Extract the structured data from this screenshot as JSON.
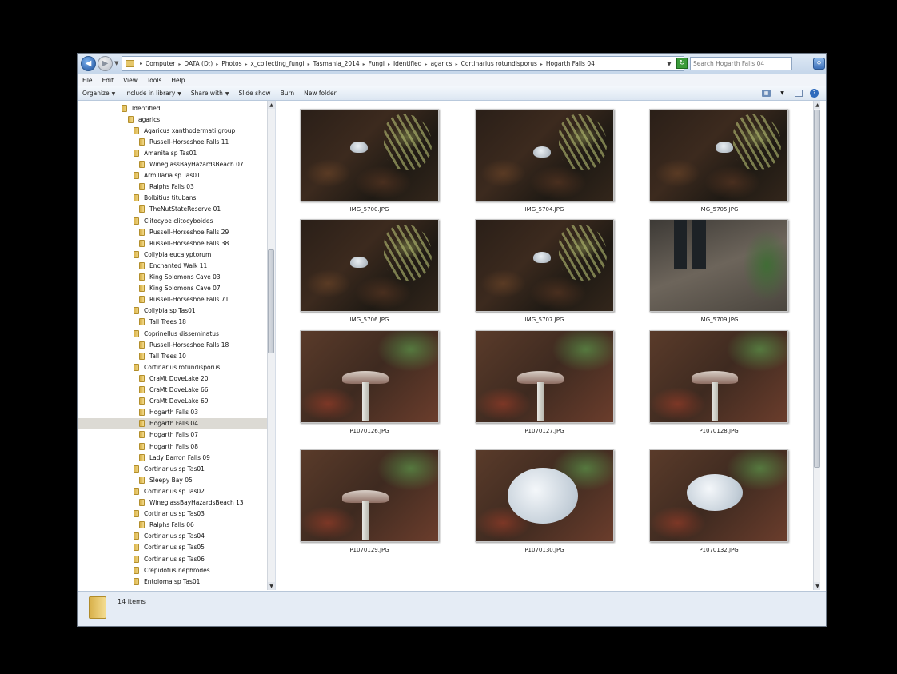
{
  "address": {
    "crumbs": [
      "Computer",
      "DATA (D:)",
      "Photos",
      "x_collecting_fungi",
      "Tasmania_2014",
      "Fungi",
      "Identified",
      "agarics",
      "Cortinarius rotundisporus",
      "Hogarth Falls 04"
    ],
    "search_placeholder": "Search Hogarth Falls 04"
  },
  "menu": [
    "File",
    "Edit",
    "View",
    "Tools",
    "Help"
  ],
  "toolbar": {
    "organize": "Organize",
    "include_in_library": "Include in library",
    "share_with": "Share with",
    "slide_show": "Slide show",
    "burn": "Burn",
    "new_folder": "New folder"
  },
  "tree": [
    {
      "label": "Identified",
      "level": 0
    },
    {
      "label": "agarics",
      "level": 1
    },
    {
      "label": "Agaricus xanthodermati group",
      "level": 2
    },
    {
      "label": "Russell-Horseshoe Falls 11",
      "level": 3
    },
    {
      "label": "Amanita sp Tas01",
      "level": 2
    },
    {
      "label": "WineglassBayHazardsBeach 07",
      "level": 3
    },
    {
      "label": "Armillaria sp Tas01",
      "level": 2
    },
    {
      "label": "Ralphs Falls 03",
      "level": 3
    },
    {
      "label": "Bolbitius titubans",
      "level": 2
    },
    {
      "label": "TheNutStateReserve 01",
      "level": 3
    },
    {
      "label": "Clitocybe clitocyboides",
      "level": 2
    },
    {
      "label": "Russell-Horseshoe Falls 29",
      "level": 3
    },
    {
      "label": "Russell-Horseshoe Falls 38",
      "level": 3
    },
    {
      "label": "Collybia eucalyptorum",
      "level": 2
    },
    {
      "label": "Enchanted Walk 11",
      "level": 3
    },
    {
      "label": "King Solomons Cave 03",
      "level": 3
    },
    {
      "label": "King Solomons Cave 07",
      "level": 3
    },
    {
      "label": "Russell-Horseshoe Falls 71",
      "level": 3
    },
    {
      "label": "Collybia sp Tas01",
      "level": 2
    },
    {
      "label": "Tall Trees 18",
      "level": 3
    },
    {
      "label": "Coprinellus disseminatus",
      "level": 2
    },
    {
      "label": "Russell-Horseshoe Falls 18",
      "level": 3
    },
    {
      "label": "Tall Trees 10",
      "level": 3
    },
    {
      "label": "Cortinarius rotundisporus",
      "level": 2
    },
    {
      "label": "CraMt DoveLake 20",
      "level": 3
    },
    {
      "label": "CraMt DoveLake 66",
      "level": 3
    },
    {
      "label": "CraMt DoveLake 69",
      "level": 3
    },
    {
      "label": "Hogarth Falls 03",
      "level": 3
    },
    {
      "label": "Hogarth Falls 04",
      "level": 3,
      "selected": true
    },
    {
      "label": "Hogarth Falls 07",
      "level": 3
    },
    {
      "label": "Hogarth Falls 08",
      "level": 3
    },
    {
      "label": "Lady Barron Falls 09",
      "level": 3
    },
    {
      "label": "Cortinarius sp Tas01",
      "level": 2
    },
    {
      "label": "Sleepy Bay 05",
      "level": 3
    },
    {
      "label": "Cortinarius sp Tas02",
      "level": 2
    },
    {
      "label": "WineglassBayHazardsBeach 13",
      "level": 3
    },
    {
      "label": "Cortinarius sp Tas03",
      "level": 2
    },
    {
      "label": "Ralphs Falls 06",
      "level": 3
    },
    {
      "label": "Cortinarius sp Tas04",
      "level": 2
    },
    {
      "label": "Cortinarius sp Tas05",
      "level": 2
    },
    {
      "label": "Cortinarius sp Tas06",
      "level": 2
    },
    {
      "label": "Crepidotus nephrodes",
      "level": 2
    },
    {
      "label": "Entoloma sp Tas01",
      "level": 2
    }
  ],
  "files": [
    {
      "name": "IMG_5700.JPG",
      "scene": "forest"
    },
    {
      "name": "IMG_5704.JPG",
      "scene": "forest"
    },
    {
      "name": "IMG_5705.JPG",
      "scene": "forest"
    },
    {
      "name": "IMG_5706.JPG",
      "scene": "forest"
    },
    {
      "name": "IMG_5707.JPG",
      "scene": "forest"
    },
    {
      "name": "IMG_5709.JPG",
      "scene": "path"
    },
    {
      "name": "P1070126.JPG",
      "scene": "tall-mushroom"
    },
    {
      "name": "P1070127.JPG",
      "scene": "tall-mushroom"
    },
    {
      "name": "P1070128.JPG",
      "scene": "tall-mushroom"
    },
    {
      "name": "P1070129.JPG",
      "scene": "tall-mushroom"
    },
    {
      "name": "P1070130.JPG",
      "scene": "cap-closeup"
    },
    {
      "name": "P1070132.JPG",
      "scene": "cap-closeup"
    }
  ],
  "status": {
    "item_count": "14 items"
  },
  "icons": {
    "back": "back-arrow-icon",
    "forward": "forward-arrow-icon",
    "refresh": "refresh-icon",
    "search": "search-icon",
    "folder": "folder-icon",
    "views": "views-icon",
    "preview_pane": "preview-pane-icon",
    "help": "help-icon"
  },
  "colors": {
    "selection": "#dcdad4",
    "chrome": "#dfe9f5",
    "backdrop": "#000000"
  }
}
